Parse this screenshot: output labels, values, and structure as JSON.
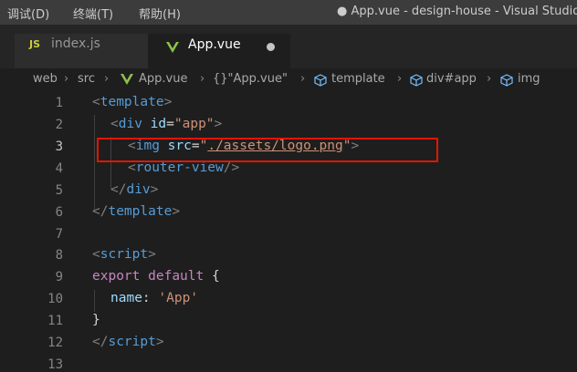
{
  "menu": [
    {
      "label": "调试(D)"
    },
    {
      "label": "终端(T)"
    },
    {
      "label": "帮助(H)"
    }
  ],
  "window_title": "● App.vue - design-house - Visual Studio",
  "tabs": [
    {
      "icon": "JS",
      "label": "index.js",
      "active": false
    },
    {
      "label": "App.vue",
      "active": true,
      "modified": true
    }
  ],
  "breadcrumb": [
    "web",
    "src",
    "App.vue",
    "{}\"App.vue\"",
    "template",
    "div#app",
    "img"
  ],
  "line_numbers": [
    "1",
    "2",
    "3",
    "4",
    "5",
    "6",
    "7",
    "8",
    "9",
    "10",
    "11",
    "12",
    "13"
  ],
  "active_line": "3",
  "code": {
    "l1": {
      "open": "<",
      "tag": "template",
      "close": ">"
    },
    "l2": {
      "open": "<",
      "tag": "div",
      "attr": "id",
      "eq": "=",
      "value": "\"app\"",
      "close": ">"
    },
    "l3": {
      "open": "<",
      "tag": "img",
      "attr": "src",
      "eq": "=",
      "q1": "\"",
      "value": "./assets/logo.png",
      "q2": "\"",
      "close": ">"
    },
    "l4": {
      "open": "<",
      "tag": "router-view",
      "close": "/>"
    },
    "l5": {
      "open": "</",
      "tag": "div",
      "close": ">"
    },
    "l6": {
      "open": "</",
      "tag": "template",
      "close": ">"
    },
    "l8": {
      "open": "<",
      "tag": "script",
      "close": ">"
    },
    "l9": {
      "kw1": "export",
      "kw2": "default",
      "brace": "{"
    },
    "l10": {
      "prop": "name",
      "colon": ": ",
      "value": "'App'"
    },
    "l11": {
      "brace": "}"
    },
    "l12": {
      "open": "</",
      "tag": "script",
      "close": ">"
    }
  }
}
